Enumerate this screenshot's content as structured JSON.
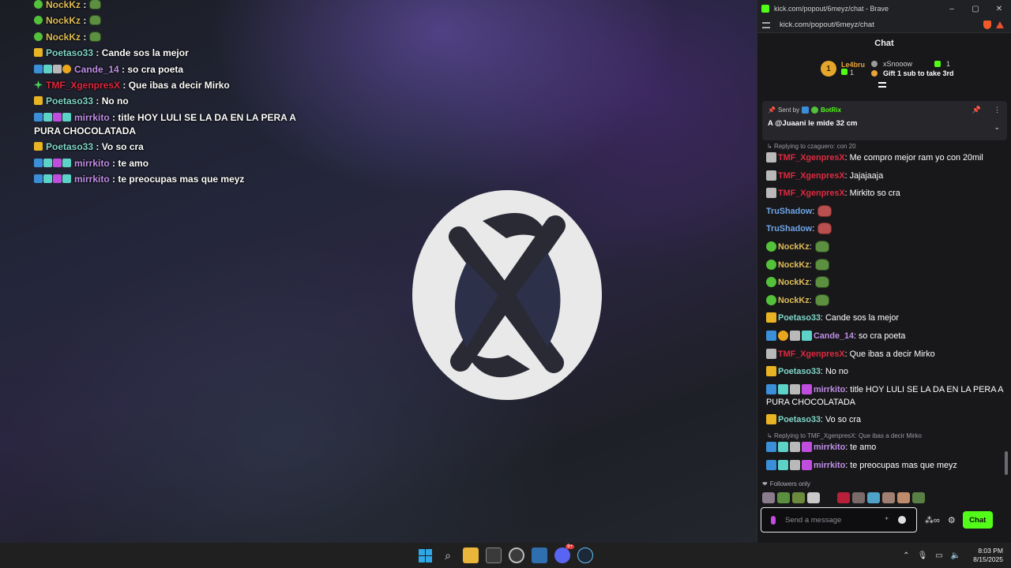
{
  "stream_overlay": {
    "lines": [
      {
        "badges": [
          "check"
        ],
        "user": "NockKz",
        "sep": " :",
        "text": "",
        "emote": "pepe"
      },
      {
        "badges": [
          "check"
        ],
        "user": "NockKz",
        "sep": " :",
        "text": "",
        "emote": "pepe"
      },
      {
        "badges": [
          "check"
        ],
        "user": "NockKz",
        "sep": " :",
        "text": "",
        "emote": "pepe"
      },
      {
        "badges": [
          "crown"
        ],
        "user": "Poetaso33",
        "sep": " :",
        "text": " Cande sos la mejor",
        "emote": ""
      },
      {
        "badges": [
          "sword",
          "cube",
          "shield",
          "one"
        ],
        "user": "Cande_14",
        "sep": " :",
        "text": " so cra poeta",
        "emote": ""
      },
      {
        "badges": [
          "star"
        ],
        "user": "TMF_XgenpresX",
        "sep": " :",
        "text": " Que ibas a decir Mirko",
        "emote": ""
      },
      {
        "badges": [
          "crown"
        ],
        "user": "Poetaso33",
        "sep": " :",
        "text": " No no",
        "emote": ""
      },
      {
        "badges": [
          "sword",
          "cube",
          "gift",
          "cube"
        ],
        "user": "mirrkito",
        "sep": " :",
        "text": " title HOY LULI SE LA DA EN LA PERA A PURA CHOCOLATADA",
        "emote": ""
      },
      {
        "badges": [
          "crown"
        ],
        "user": "Poetaso33",
        "sep": " :",
        "text": " Vo so cra",
        "emote": ""
      },
      {
        "badges": [
          "sword",
          "cube",
          "gift",
          "cube"
        ],
        "user": "mirrkito",
        "sep": " :",
        "text": " te amo",
        "emote": ""
      },
      {
        "badges": [
          "sword",
          "cube",
          "gift",
          "cube"
        ],
        "user": "mirrkito",
        "sep": " :",
        "text": " te preocupas mas que meyz",
        "emote": ""
      }
    ],
    "user_colors": {
      "NockKz": "#e0be55",
      "Poetaso33": "#7fd6c8",
      "Cande_14": "#c08ee6",
      "TMF_XgenpresX": "#e0293f",
      "mirrkito": "#c08ee6"
    }
  },
  "window": {
    "title": "kick.com/popout/6meyz/chat - Brave",
    "url": "kick.com/popout/6meyz/chat",
    "minimize": "–",
    "maximize": "▢",
    "close": "✕"
  },
  "chat": {
    "header": "Chat",
    "leaderboard": {
      "first_rank": "1",
      "first_name": "Le4bru",
      "first_count": "1",
      "second_name": "xSnooow",
      "second_count": "1",
      "gift_cta": "Gift 1 sub to take 3rd"
    },
    "pinned": {
      "sent_by_label": "Sent by",
      "sender": "BotRix",
      "message": "A @Juaani le mide 32 cm"
    },
    "messages": [
      {
        "reply": "Replying to czaguero: con 20"
      },
      {
        "badges": [
          "shield"
        ],
        "user": "TMF_XgenpresX",
        "color": "red",
        "text": ": Me compro mejor ram yo con 20mil"
      },
      {
        "badges": [
          "shield"
        ],
        "user": "TMF_XgenpresX",
        "color": "red",
        "text": ": Jajajaaja"
      },
      {
        "badges": [
          "shield"
        ],
        "user": "TMF_XgenpresX",
        "color": "red",
        "text": ": Mirkito so cra"
      },
      {
        "badges": [],
        "user": "TruShadow",
        "color": "blue",
        "text": ":",
        "emote": "red"
      },
      {
        "badges": [],
        "user": "TruShadow",
        "color": "blue",
        "text": ":",
        "emote": "red"
      },
      {
        "badges": [
          "check"
        ],
        "user": "NockKz",
        "color": "gold",
        "text": ":",
        "emote": "pepe"
      },
      {
        "badges": [
          "check"
        ],
        "user": "NockKz",
        "color": "gold",
        "text": ":",
        "emote": "pepe"
      },
      {
        "badges": [
          "check"
        ],
        "user": "NockKz",
        "color": "gold",
        "text": ":",
        "emote": "pepe"
      },
      {
        "badges": [
          "check"
        ],
        "user": "NockKz",
        "color": "gold",
        "text": ":",
        "emote": "pepe"
      },
      {
        "badges": [
          "crown"
        ],
        "user": "Poetaso33",
        "color": "teal",
        "text": ": Cande sos la mejor"
      },
      {
        "badges": [
          "sword",
          "one",
          "shield",
          "cube"
        ],
        "user": "Cande_14",
        "color": "purple",
        "text": ": so cra poeta"
      },
      {
        "badges": [
          "shield"
        ],
        "user": "TMF_XgenpresX",
        "color": "red",
        "text": ": Que ibas a decir Mirko"
      },
      {
        "badges": [
          "crown"
        ],
        "user": "Poetaso33",
        "color": "teal",
        "text": ": No no"
      },
      {
        "badges": [
          "sword",
          "cube",
          "shield",
          "gift"
        ],
        "user": "mirrkito",
        "color": "purple",
        "text": ": title HOY LULI SE LA DA EN LA PERA A PURA CHOCOLATADA"
      },
      {
        "badges": [
          "crown"
        ],
        "user": "Poetaso33",
        "color": "teal",
        "text": ": Vo so cra"
      },
      {
        "reply": "Replying to TMF_XgenpresX: Que ibas a decir Mirko"
      },
      {
        "badges": [
          "sword",
          "cube",
          "shield",
          "gift"
        ],
        "user": "mirrkito",
        "color": "purple",
        "text": ": te amo"
      },
      {
        "badges": [
          "sword",
          "cube",
          "shield",
          "gift"
        ],
        "user": "mirrkito",
        "color": "purple",
        "text": ": te preocupas mas que meyz"
      }
    ],
    "followers_only": "Followers only",
    "input_placeholder": "Send a message",
    "send_label": "Chat"
  },
  "taskbar": {
    "icons": [
      "windows-start-icon",
      "search-icon",
      "file-explorer-icon",
      "store-icon",
      "chrome-icon",
      "brave-icon",
      "discord-icon",
      "steam-icon"
    ],
    "discord_badge": "9+",
    "time": "8:03 PM",
    "date": "8/15/2025"
  },
  "colors": {
    "kick_green": "#53fc18",
    "chat_bg": "#18181b",
    "pinned_bg": "#26262b"
  }
}
